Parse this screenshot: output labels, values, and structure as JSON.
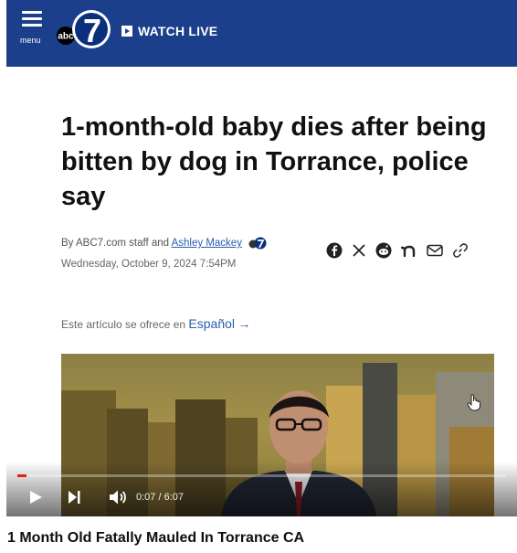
{
  "header": {
    "menu_label": "menu",
    "logo_text": "abc",
    "logo_number": "7",
    "watch_live_label": "WATCH LIVE",
    "bg_color": "#1b3f8b"
  },
  "article": {
    "headline": "1-month-old baby dies after being bitten by dog in Torrance, police say",
    "byline_prefix": "By ABC7.com staff and ",
    "author": "Ashley Mackey",
    "date": "Wednesday, October 9, 2024 7:54PM",
    "share_icons": [
      "facebook-icon",
      "x-icon",
      "reddit-icon",
      "nextdoor-icon",
      "email-icon",
      "link-icon"
    ],
    "spanish_prefix": "Este artículo se ofrece en ",
    "spanish_link": "Español",
    "spanish_arrow": "→"
  },
  "player": {
    "time_display": "0:07 / 6:07",
    "progress_fraction": 0.019,
    "progress_color": "#e62117",
    "video_title": "1 Month Old Fatally Mauled In Torrance CA"
  }
}
